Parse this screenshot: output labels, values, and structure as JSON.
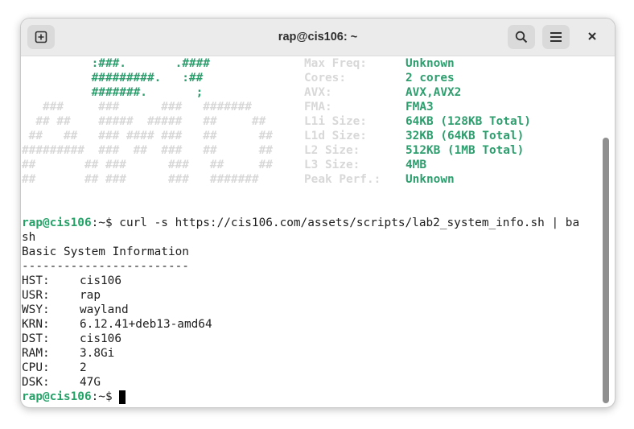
{
  "window": {
    "title": "rap@cis106: ~"
  },
  "toolbar": {
    "new_tab_icon": "new-tab-icon",
    "search_icon": "search-icon",
    "menu_icon": "hamburger-menu-icon",
    "close_icon": "close-icon"
  },
  "colors": {
    "prompt_green": "#26a269",
    "info_green": "#2e9e6e",
    "logo_gray": "#d8d8d8"
  },
  "terminal": {
    "logo_lines": [
      {
        "g": "          :###.       .####",
        "w": ""
      },
      {
        "g": "          #########.   :##",
        "w": ""
      },
      {
        "g": "          #######.       ;",
        "w": ""
      },
      {
        "g": "",
        "w": "   ###     ###      ###   #######"
      },
      {
        "g": "",
        "w": "  ## ##    #####  #####   ##     ##"
      },
      {
        "g": "",
        "w": " ##   ##   ### #### ###   ##      ##"
      },
      {
        "g": "",
        "w": "#########  ###  ##  ###   ##      ##"
      },
      {
        "g": "",
        "w": "##       ## ###      ###   ##     ##"
      },
      {
        "g": "",
        "w": "##       ## ###      ###   #######"
      }
    ],
    "info": [
      {
        "key": "Max Freq:",
        "value": "Unknown"
      },
      {
        "key": "Cores:",
        "value": "2 cores"
      },
      {
        "key": "AVX:",
        "value": "AVX,AVX2"
      },
      {
        "key": "FMA:",
        "value": "FMA3"
      },
      {
        "key": "L1i Size:",
        "value": "64KB (128KB Total)"
      },
      {
        "key": "L1d Size:",
        "value": "32KB (64KB Total)"
      },
      {
        "key": "L2 Size:",
        "value": "512KB (1MB Total)"
      },
      {
        "key": "L3 Size:",
        "value": "4MB"
      },
      {
        "key": "Peak Perf.:",
        "value": "Unknown"
      }
    ],
    "prompt_user": "rap@cis106",
    "prompt_path": ":~$ ",
    "command_line1": "curl -s https://cis106.com/assets/scripts/lab2_system_info.sh | ba",
    "command_line2": "sh",
    "output_header": "Basic System Information",
    "output_divider": "------------------------",
    "system_info": [
      {
        "label": "HST:",
        "value": "cis106"
      },
      {
        "label": "USR:",
        "value": "rap"
      },
      {
        "label": "WSY:",
        "value": "wayland"
      },
      {
        "label": "KRN:",
        "value": "6.12.41+deb13-amd64"
      },
      {
        "label": "DST:",
        "value": "cis106"
      },
      {
        "label": "RAM:",
        "value": "3.8Gi"
      },
      {
        "label": "CPU:",
        "value": "2"
      },
      {
        "label": "DSK:",
        "value": "47G"
      }
    ]
  }
}
